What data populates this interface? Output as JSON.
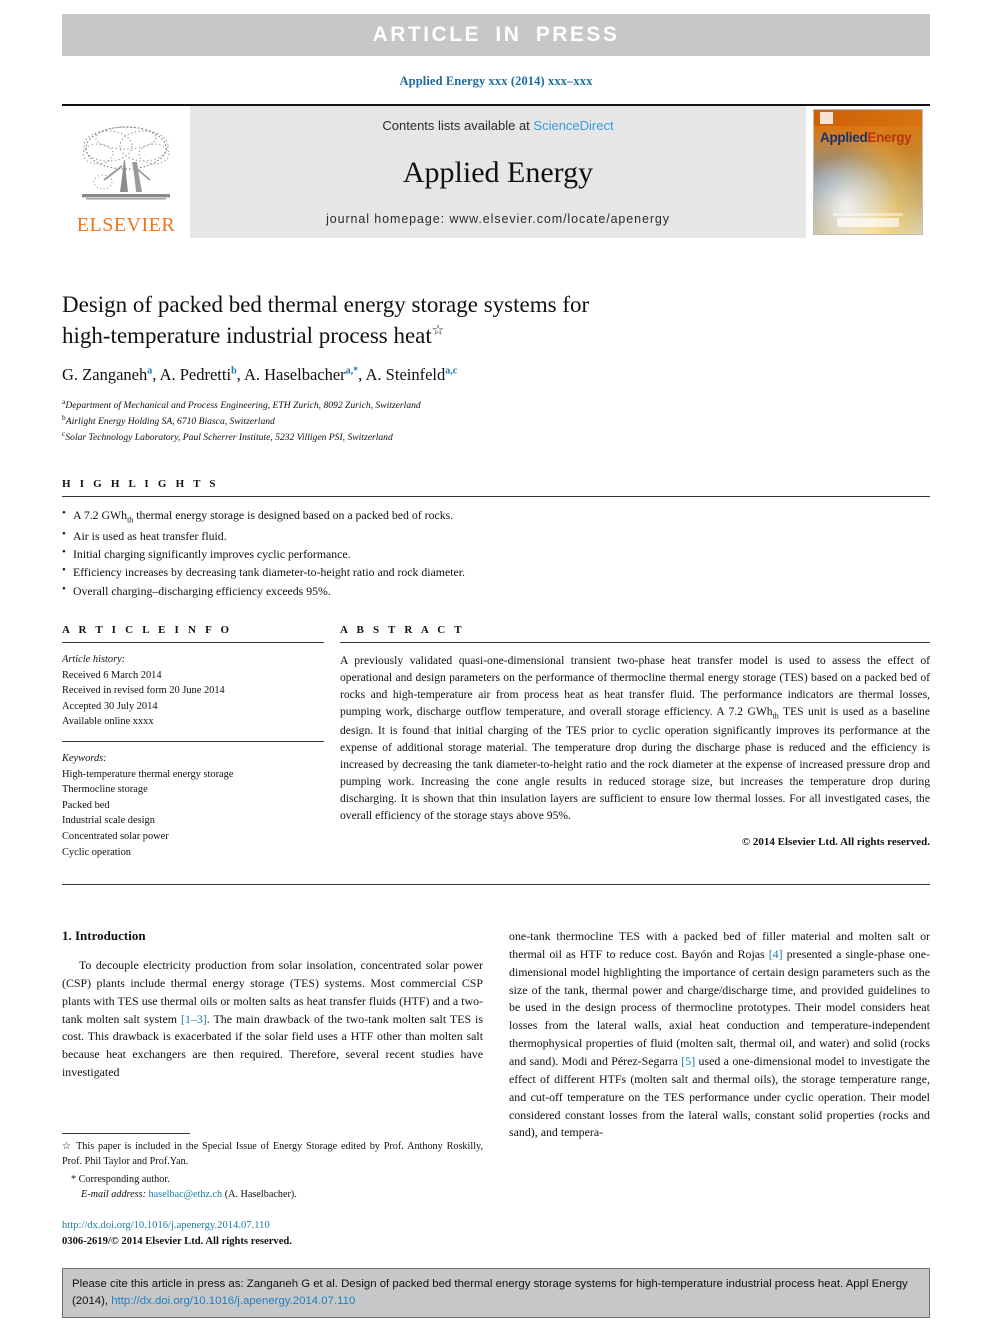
{
  "banner": {
    "label": "ARTICLE IN PRESS"
  },
  "journal_line": "Applied Energy xxx (2014) xxx–xxx",
  "masthead": {
    "publisher_word": "ELSEVIER",
    "contents_prefix": "Contents lists available at ",
    "contents_link": "ScienceDirect",
    "journal_title": "Applied Energy",
    "homepage": "journal homepage: www.elsevier.com/locate/apenergy",
    "cover": {
      "title_part1": "Applied",
      "title_part2": "Energy"
    }
  },
  "article": {
    "title_line1": "Design of packed bed thermal energy storage systems for",
    "title_line2": "high-temperature industrial process heat",
    "title_footnote_mark": "☆",
    "authors": [
      {
        "name": "G. Zanganeh",
        "sup": "a"
      },
      {
        "name": "A. Pedretti",
        "sup": "b"
      },
      {
        "name": "A. Haselbacher",
        "sup": "a,*"
      },
      {
        "name": "A. Steinfeld",
        "sup": "a,c"
      }
    ],
    "affiliations": [
      {
        "mark": "a",
        "text": "Department of Mechanical and Process Engineering, ETH Zurich, 8092 Zurich, Switzerland"
      },
      {
        "mark": "b",
        "text": "Airlight Energy Holding SA, 6710 Biasca, Switzerland"
      },
      {
        "mark": "c",
        "text": "Solar Technology Laboratory, Paul Scherrer Institute, 5232 Villigen PSI, Switzerland"
      }
    ]
  },
  "highlights": {
    "heading": "H I G H L I G H T S",
    "items": [
      "A 7.2 GWh_th thermal energy storage is designed based on a packed bed of rocks.",
      "Air is used as heat transfer fluid.",
      "Initial charging significantly improves cyclic performance.",
      "Efficiency increases by decreasing tank diameter-to-height ratio and rock diameter.",
      "Overall charging–discharging efficiency exceeds 95%."
    ],
    "item1_prefix": "A 7.2 GWh",
    "item1_sub": "th",
    "item1_suffix": " thermal energy storage is designed based on a packed bed of rocks."
  },
  "article_info": {
    "heading": "A R T I C L E    I N F O",
    "history_label": "Article history:",
    "history": [
      "Received 6 March 2014",
      "Received in revised form 20 June 2014",
      "Accepted 30 July 2014",
      "Available online xxxx"
    ],
    "keywords_label": "Keywords:",
    "keywords": [
      "High-temperature thermal energy storage",
      "Thermocline storage",
      "Packed bed",
      "Industrial scale design",
      "Concentrated solar power",
      "Cyclic operation"
    ]
  },
  "abstract": {
    "heading": "A B S T R A C T",
    "part1": "A previously validated quasi-one-dimensional transient two-phase heat transfer model is used to assess the effect of operational and design parameters on the performance of thermocline thermal energy storage (TES) based on a packed bed of rocks and high-temperature air from process heat as heat transfer fluid. The performance indicators are thermal losses, pumping work, discharge outflow temperature, and overall storage efficiency. A 7.2 GWh",
    "sub": "th",
    "part2": " TES unit is used as a baseline design. It is found that initial charging of the TES prior to cyclic operation significantly improves its performance at the expense of additional storage material. The temperature drop during the discharge phase is reduced and the efficiency is increased by decreasing the tank diameter-to-height ratio and the rock diameter at the expense of increased pressure drop and pumping work. Increasing the cone angle results in reduced storage size, but increases the temperature drop during discharging. It is shown that thin insulation layers are sufficient to ensure low thermal losses. For all investigated cases, the overall efficiency of the storage stays above 95%.",
    "copyright": "© 2014 Elsevier Ltd. All rights reserved."
  },
  "introduction": {
    "section_title": "1. Introduction",
    "left_para_a": "To decouple electricity production from solar insolation, concentrated solar power (CSP) plants include thermal energy storage (TES) systems. Most commercial CSP plants with TES use thermal oils or molten salts as heat transfer fluids (HTF) and a two-tank molten salt system ",
    "left_ref_1": "[1–3]",
    "left_para_b": ". The main drawback of the two-tank molten salt TES is cost. This drawback is exacerbated if the solar field uses a HTF other than molten salt because heat exchangers are then required. Therefore, several recent studies have investigated",
    "right_para_a": "one-tank thermocline TES with a packed bed of filler material and molten salt or thermal oil as HTF to reduce cost. Bayón and Rojas ",
    "right_ref_4": "[4]",
    "right_para_b": " presented a single-phase one-dimensional model highlighting the importance of certain design parameters such as the size of the tank, thermal power and charge/discharge time, and provided guidelines to be used in the design process of thermocline prototypes. Their model considers heat losses from the lateral walls, axial heat conduction and temperature-independent thermophysical properties of fluid (molten salt, thermal oil, and water) and solid (rocks and sand). Modi and Pérez-Segarra ",
    "right_ref_5": "[5]",
    "right_para_c": " used a one-dimensional model to investigate the effect of different HTFs (molten salt and thermal oils), the storage temperature range, and cut-off temperature on the TES performance under cyclic operation. Their model considered constant losses from the lateral walls, constant solid properties (rocks and sand), and tempera-"
  },
  "footnotes": {
    "special_issue": "☆ This paper is included in the Special Issue of Energy Storage edited by Prof. Anthony Roskilly, Prof. Phil Taylor and Prof.Yan.",
    "corresponding": "* Corresponding author.",
    "email_label": "E-mail address:",
    "email": "haselbac@ethz.ch",
    "email_owner": "(A. Haselbacher).",
    "doi": "http://dx.doi.org/10.1016/j.apenergy.2014.07.110",
    "issn": "0306-2619/© 2014 Elsevier Ltd. All rights reserved."
  },
  "cite_footer": {
    "text": "Please cite this article in press as: Zanganeh G et al. Design of packed bed thermal energy storage systems for high-temperature industrial process heat. Appl Energy (2014), ",
    "link": "http://dx.doi.org/10.1016/j.apenergy.2014.07.110"
  },
  "colors": {
    "banner_bg": "#c6c7c9",
    "link_blue": "#1a7ba8",
    "sciencedirect_blue": "#3a9bd5",
    "elsevier_orange": "#e87722",
    "masthead_gray": "#e6e6e6"
  }
}
